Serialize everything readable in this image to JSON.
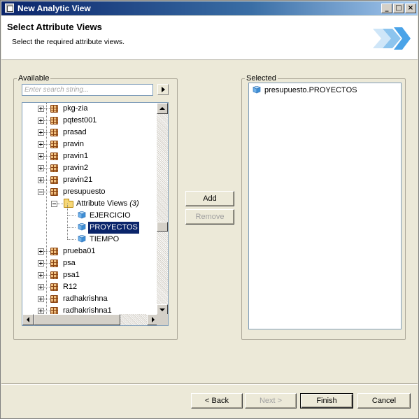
{
  "window": {
    "title": "New Analytic View",
    "minimize": "_",
    "maximize": "□",
    "close": "×"
  },
  "header": {
    "title": "Select Attribute Views",
    "subtitle": "Select the required attribute views."
  },
  "available": {
    "legend": "Available",
    "search_placeholder": "Enter search string...",
    "tree": [
      {
        "label": "pkg-zia",
        "type": "package",
        "state": "collapsed"
      },
      {
        "label": "pqtest001",
        "type": "package",
        "state": "collapsed"
      },
      {
        "label": "prasad",
        "type": "package",
        "state": "collapsed"
      },
      {
        "label": "pravin",
        "type": "package",
        "state": "collapsed"
      },
      {
        "label": "pravin1",
        "type": "package",
        "state": "collapsed"
      },
      {
        "label": "pravin2",
        "type": "package",
        "state": "collapsed"
      },
      {
        "label": "pravin21",
        "type": "package",
        "state": "collapsed"
      },
      {
        "label": "presupuesto",
        "type": "package",
        "state": "expanded"
      },
      {
        "label": "Attribute Views",
        "count": "(3)",
        "type": "folder",
        "state": "expanded"
      },
      {
        "label": "EJERCICIO",
        "type": "view"
      },
      {
        "label": "PROYECTOS",
        "type": "view",
        "selected": true
      },
      {
        "label": "TIEMPO",
        "type": "view"
      },
      {
        "label": "prueba01",
        "type": "package",
        "state": "collapsed"
      },
      {
        "label": "psa",
        "type": "package",
        "state": "collapsed"
      },
      {
        "label": "psa1",
        "type": "package",
        "state": "collapsed"
      },
      {
        "label": "R12",
        "type": "package",
        "state": "collapsed"
      },
      {
        "label": "radhakrishna",
        "type": "package",
        "state": "collapsed"
      },
      {
        "label": "radhakrishna1",
        "type": "package",
        "state": "collapsed"
      }
    ]
  },
  "actions": {
    "add": "Add",
    "remove": "Remove"
  },
  "selected": {
    "legend": "Selected",
    "items": [
      {
        "label": "presupuesto.PROYECTOS",
        "type": "view"
      }
    ]
  },
  "footer": {
    "back": "< Back",
    "next": "Next >",
    "finish": "Finish",
    "cancel": "Cancel"
  },
  "colors": {
    "title_bar": "#0a246a",
    "selection": "#0a246a",
    "dialog_bg": "#ece9d8",
    "accent_chevrons": "#4aa3e8"
  }
}
